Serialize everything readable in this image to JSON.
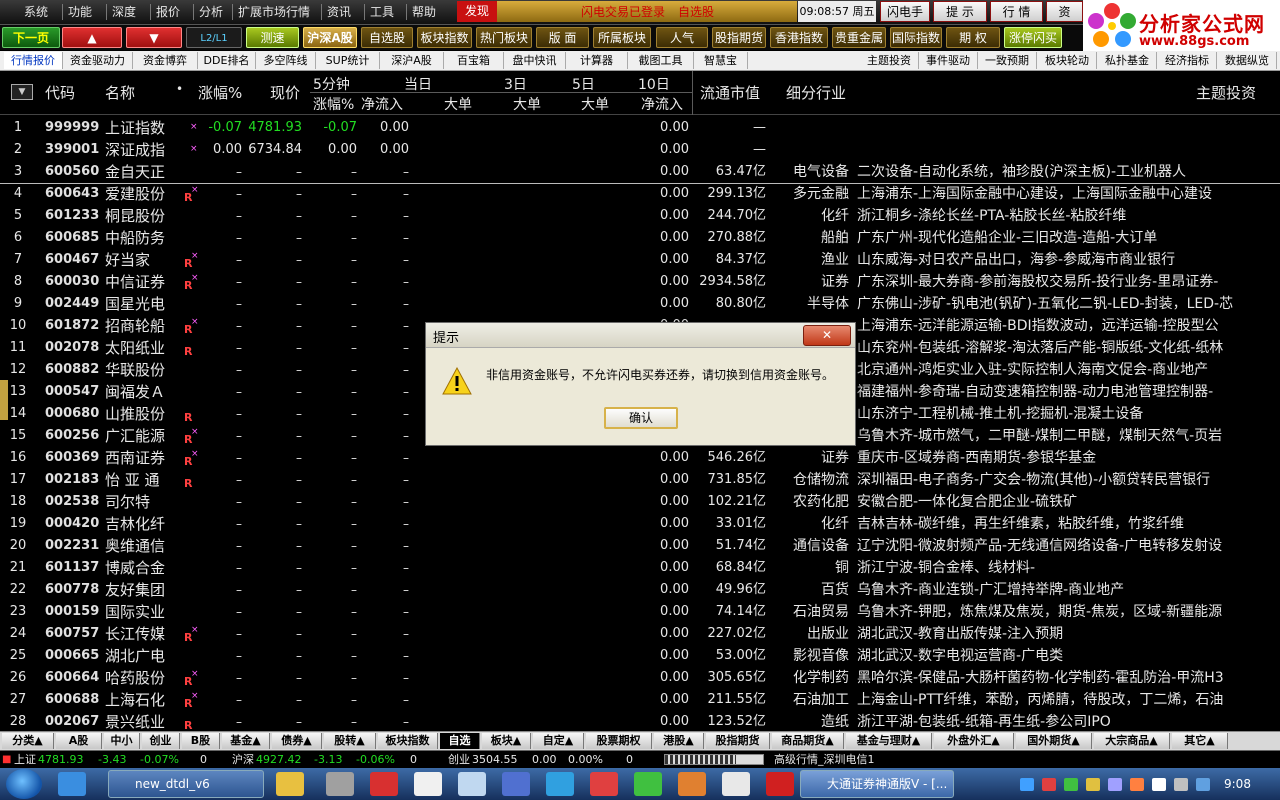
{
  "menu": {
    "items": [
      "系统",
      "功能",
      "深度",
      "报价",
      "分析",
      "扩展市场行情",
      "资讯",
      "工具",
      "帮助"
    ],
    "discover": "发现",
    "flash_status": "闪电交易已登录",
    "watchlist": "自选股",
    "time": "09:08:57 周五",
    "buttons": [
      "闪电手",
      "提 示",
      "行 情",
      "资"
    ]
  },
  "logo": {
    "title": "分析家公式网",
    "url": "www.88gs.com"
  },
  "toolbar": [
    {
      "label": "下一页>>",
      "style": "green"
    },
    {
      "label": "▲",
      "style": "red"
    },
    {
      "label": "▼",
      "style": "red"
    },
    {
      "label": "L2/L1",
      "style": "blue"
    },
    {
      "label": "测速",
      "style": "lime"
    },
    {
      "label": "沪深A股",
      "style": "sel"
    },
    {
      "label": "自选股",
      "style": "gold"
    },
    {
      "label": "板块指数",
      "style": "gold"
    },
    {
      "label": "热门板块",
      "style": "gold"
    },
    {
      "label": "版 面",
      "style": "gold"
    },
    {
      "label": "所属板块",
      "style": "gold"
    },
    {
      "label": "人气",
      "style": "gold"
    },
    {
      "label": "股指期货",
      "style": "gold"
    },
    {
      "label": "香港指数",
      "style": "gold"
    },
    {
      "label": "贵重金属",
      "style": "gold"
    },
    {
      "label": "国际指数",
      "style": "gold"
    },
    {
      "label": "期 权",
      "style": "gold"
    },
    {
      "label": "涨停闪买",
      "style": "lime"
    }
  ],
  "subtabs_left": [
    "行情报价",
    "资金驱动力",
    "资金博弈",
    "DDE排名",
    "多空阵线",
    "SUP统计",
    "深沪A股",
    "百宝箱",
    "盘中快讯",
    "计算器",
    "截图工具",
    "智慧宝"
  ],
  "subtabs_right": [
    "主题投资",
    "事件驱动",
    "一致预期",
    "板块轮动",
    "私扑基金",
    "经济指标",
    "数据纵览"
  ],
  "table": {
    "sort_icon": "▼",
    "headers": {
      "code": "代码",
      "name": "名称",
      "dot": "•",
      "chg": "涨幅%",
      "price": "现价",
      "min5": "5分钟",
      "min5_sub": "涨幅%",
      "today": "当日",
      "today_net": "净流入",
      "today_big": "大单",
      "d3": "3日",
      "d3_big": "大单",
      "d5": "5日",
      "d5_big": "大单",
      "d10": "10日",
      "d10_net": "净流入",
      "mcap": "流通市值",
      "industry": "细分行业",
      "theme": "主题投资"
    },
    "rows": [
      {
        "no": "1",
        "code": "999999",
        "name": "上证指数",
        "badge": "",
        "mark": "×",
        "chg": "-0.07",
        "price": "4781.93",
        "m5": "-0.07",
        "today": "0.00",
        "d10": "0.00",
        "mcap": "—",
        "ind": "",
        "theme": "",
        "hi": "green"
      },
      {
        "no": "2",
        "code": "399001",
        "name": "深证成指",
        "badge": "",
        "mark": "×",
        "chg": "0.00",
        "price": "6734.84",
        "m5": "0.00",
        "today": "0.00",
        "d10": "0.00",
        "mcap": "—",
        "ind": "",
        "theme": "",
        "hi": ""
      },
      {
        "no": "3",
        "code": "600560",
        "name": "金自天正",
        "badge": "",
        "mark": "",
        "chg": "–",
        "price": "–",
        "m5": "–",
        "today": "–",
        "d10": "0.00",
        "mcap": "63.47亿",
        "ind": "电气设备",
        "theme": "二次设备-自动化系统，袖珍股(沪深主板)-工业机器人",
        "hi": ""
      },
      {
        "no": "4",
        "code": "600643",
        "name": "爱建股份",
        "badge": "R",
        "mark": "×",
        "chg": "–",
        "price": "–",
        "m5": "–",
        "today": "–",
        "d10": "0.00",
        "mcap": "299.13亿",
        "ind": "多元金融",
        "theme": "上海浦东-上海国际金融中心建设，上海国际金融中心建设",
        "hi": ""
      },
      {
        "no": "5",
        "code": "601233",
        "name": "桐昆股份",
        "badge": "",
        "mark": "",
        "chg": "–",
        "price": "–",
        "m5": "–",
        "today": "–",
        "d10": "0.00",
        "mcap": "244.70亿",
        "ind": "化纤",
        "theme": "浙江桐乡-涤纶长丝-PTA-粘胶长丝-粘胶纤维",
        "hi": ""
      },
      {
        "no": "6",
        "code": "600685",
        "name": "中船防务",
        "badge": "",
        "mark": "",
        "chg": "–",
        "price": "–",
        "m5": "–",
        "today": "–",
        "d10": "0.00",
        "mcap": "270.88亿",
        "ind": "船舶",
        "theme": "广东广州-现代化造船企业-三旧改造-造船-大订单",
        "hi": ""
      },
      {
        "no": "7",
        "code": "600467",
        "name": "好当家",
        "badge": "R",
        "mark": "×",
        "chg": "–",
        "price": "–",
        "m5": "–",
        "today": "–",
        "d10": "0.00",
        "mcap": "84.37亿",
        "ind": "渔业",
        "theme": "山东威海-对日农产品出口，海参-参威海市商业银行",
        "hi": ""
      },
      {
        "no": "8",
        "code": "600030",
        "name": "中信证券",
        "badge": "R",
        "mark": "×",
        "chg": "–",
        "price": "–",
        "m5": "–",
        "today": "–",
        "d10": "0.00",
        "mcap": "2934.58亿",
        "ind": "证券",
        "theme": "广东深圳-最大券商-参前海股权交易所-投行业务-里昂证券-",
        "hi": ""
      },
      {
        "no": "9",
        "code": "002449",
        "name": "国星光电",
        "badge": "",
        "mark": "",
        "chg": "–",
        "price": "–",
        "m5": "–",
        "today": "–",
        "d10": "0.00",
        "mcap": "80.80亿",
        "ind": "半导体",
        "theme": "广东佛山-涉矿-钒电池(钒矿)-五氧化二钒-LED-封装，LED-芯",
        "hi": ""
      },
      {
        "no": "10",
        "code": "601872",
        "name": "招商轮船",
        "badge": "R",
        "mark": "×",
        "chg": "–",
        "price": "–",
        "m5": "–",
        "today": "–",
        "d10": "0.00",
        "mcap": "",
        "ind": "",
        "theme": "上海浦东-远洋能源运输-BDI指数波动，远洋运输-控股型公",
        "hi": ""
      },
      {
        "no": "11",
        "code": "002078",
        "name": "太阳纸业",
        "badge": "R",
        "mark": "",
        "chg": "–",
        "price": "–",
        "m5": "–",
        "today": "–",
        "d10": "0.00",
        "mcap": "",
        "ind": "",
        "theme": "山东兖州-包装纸-溶解浆-淘汰落后产能-铜版纸-文化纸-纸林",
        "hi": ""
      },
      {
        "no": "12",
        "code": "600882",
        "name": "华联股份",
        "badge": "",
        "mark": "",
        "chg": "–",
        "price": "–",
        "m5": "–",
        "today": "–",
        "d10": "0.00",
        "mcap": "",
        "ind": "",
        "theme": "北京通州-鸿炬实业入驻-实际控制人海南文促会-商业地产",
        "hi": ""
      },
      {
        "no": "13",
        "code": "000547",
        "name": "闽福发Ａ",
        "badge": "",
        "mark": "",
        "chg": "–",
        "price": "–",
        "m5": "–",
        "today": "–",
        "d10": "0.00",
        "mcap": "",
        "ind": "",
        "theme": "福建福州-参奇瑞-自动变速箱控制器-动力电池管理控制器-",
        "hi": ""
      },
      {
        "no": "14",
        "code": "000680",
        "name": "山推股份",
        "badge": "R",
        "mark": "",
        "chg": "–",
        "price": "–",
        "m5": "–",
        "today": "–",
        "d10": "0.00",
        "mcap": "",
        "ind": "",
        "theme": "山东济宁-工程机械-推土机-挖掘机-混凝土设备",
        "hi": ""
      },
      {
        "no": "15",
        "code": "600256",
        "name": "广汇能源",
        "badge": "R",
        "mark": "×",
        "chg": "–",
        "price": "–",
        "m5": "–",
        "today": "–",
        "d10": "0.00",
        "mcap": "",
        "ind": "",
        "theme": "乌鲁木齐-城市燃气，二甲醚-煤制二甲醚，煤制天然气-页岩",
        "hi": ""
      },
      {
        "no": "16",
        "code": "600369",
        "name": "西南证券",
        "badge": "R",
        "mark": "×",
        "chg": "–",
        "price": "–",
        "m5": "–",
        "today": "–",
        "d10": "0.00",
        "mcap": "546.26亿",
        "ind": "证券",
        "theme": "重庆市-区域券商-西南期货-参银华基金",
        "hi": ""
      },
      {
        "no": "17",
        "code": "002183",
        "name": "怡 亚 通",
        "badge": "R",
        "mark": "",
        "chg": "–",
        "price": "–",
        "m5": "–",
        "today": "–",
        "d10": "0.00",
        "mcap": "731.85亿",
        "ind": "仓储物流",
        "theme": "深圳福田-电子商务-广交会-物流(其他)-小额贷转民营银行",
        "hi": ""
      },
      {
        "no": "18",
        "code": "002538",
        "name": "司尔特",
        "badge": "",
        "mark": "",
        "chg": "–",
        "price": "–",
        "m5": "–",
        "today": "–",
        "d10": "0.00",
        "mcap": "102.21亿",
        "ind": "农药化肥",
        "theme": "安徽合肥-一体化复合肥企业-硫铁矿",
        "hi": ""
      },
      {
        "no": "19",
        "code": "000420",
        "name": "吉林化纤",
        "badge": "",
        "mark": "",
        "chg": "–",
        "price": "–",
        "m5": "–",
        "today": "–",
        "d10": "0.00",
        "mcap": "33.01亿",
        "ind": "化纤",
        "theme": "吉林吉林-碳纤维，再生纤维素，粘胶纤维，竹浆纤维",
        "hi": ""
      },
      {
        "no": "20",
        "code": "002231",
        "name": "奥维通信",
        "badge": "",
        "mark": "",
        "chg": "–",
        "price": "–",
        "m5": "–",
        "today": "–",
        "d10": "0.00",
        "mcap": "51.74亿",
        "ind": "通信设备",
        "theme": "辽宁沈阳-微波射频产品-无线通信网络设备-广电转移发射设",
        "hi": ""
      },
      {
        "no": "21",
        "code": "601137",
        "name": "博威合金",
        "badge": "",
        "mark": "",
        "chg": "–",
        "price": "–",
        "m5": "–",
        "today": "–",
        "d10": "0.00",
        "mcap": "68.84亿",
        "ind": "铜",
        "theme": "浙江宁波-铜合金棒、线材料-",
        "hi": ""
      },
      {
        "no": "22",
        "code": "600778",
        "name": "友好集团",
        "badge": "",
        "mark": "",
        "chg": "–",
        "price": "–",
        "m5": "–",
        "today": "–",
        "d10": "0.00",
        "mcap": "49.96亿",
        "ind": "百货",
        "theme": "乌鲁木齐-商业连锁-广汇增持举牌-商业地产",
        "hi": ""
      },
      {
        "no": "23",
        "code": "000159",
        "name": "国际实业",
        "badge": "",
        "mark": "",
        "chg": "–",
        "price": "–",
        "m5": "–",
        "today": "–",
        "d10": "0.00",
        "mcap": "74.14亿",
        "ind": "石油贸易",
        "theme": "乌鲁木齐-钾肥，炼焦煤及焦炭，期货-焦炭，区域-新疆能源",
        "hi": ""
      },
      {
        "no": "24",
        "code": "600757",
        "name": "长江传媒",
        "badge": "R",
        "mark": "×",
        "chg": "–",
        "price": "–",
        "m5": "–",
        "today": "–",
        "d10": "0.00",
        "mcap": "227.02亿",
        "ind": "出版业",
        "theme": "湖北武汉-教育出版传媒-注入预期",
        "hi": ""
      },
      {
        "no": "25",
        "code": "000665",
        "name": "湖北广电",
        "badge": "",
        "mark": "",
        "chg": "–",
        "price": "–",
        "m5": "–",
        "today": "–",
        "d10": "0.00",
        "mcap": "53.00亿",
        "ind": "影视音像",
        "theme": "湖北武汉-数字电视运营商-广电类",
        "hi": ""
      },
      {
        "no": "26",
        "code": "600664",
        "name": "哈药股份",
        "badge": "R",
        "mark": "×",
        "chg": "–",
        "price": "–",
        "m5": "–",
        "today": "–",
        "d10": "0.00",
        "mcap": "305.65亿",
        "ind": "化学制药",
        "theme": "黑哈尔滨-保健品-大肠杆菌药物-化学制药-霍乱防治-甲流H3",
        "hi": ""
      },
      {
        "no": "27",
        "code": "600688",
        "name": "上海石化",
        "badge": "R",
        "mark": "×",
        "chg": "–",
        "price": "–",
        "m5": "–",
        "today": "–",
        "d10": "0.00",
        "mcap": "211.55亿",
        "ind": "石油加工",
        "theme": "上海金山-PTT纤维，苯酚，丙烯腈，待股改，丁二烯，石油",
        "hi": ""
      },
      {
        "no": "28",
        "code": "002067",
        "name": "景兴纸业",
        "badge": "R",
        "mark": "",
        "chg": "–",
        "price": "–",
        "m5": "–",
        "today": "–",
        "d10": "0.00",
        "mcap": "123.52亿",
        "ind": "造纸",
        "theme": "浙江平湖-包装纸-纸箱-再生纸-参公司IPO",
        "hi": ""
      }
    ]
  },
  "dialog": {
    "title": "提示",
    "close": "✕",
    "message": "非信用资金账号，不允许闪电买券还券，请切换到信用资金账号。",
    "ok": "确认"
  },
  "bottom_tabs": [
    "分类▲",
    "A股",
    "中小",
    "创业",
    "B股",
    "基金▲",
    "债券▲",
    "股转▲",
    "板块指数",
    "自选",
    "板块▲",
    "自定▲",
    "股票期权",
    "港股▲",
    "股指期货",
    "商品期货▲",
    "基金与理财▲",
    "外盘外汇▲",
    "国外期货▲",
    "大宗商品▲",
    "其它▲"
  ],
  "status": {
    "sh_label": "上证",
    "sh_val": "4781.93",
    "sh_chg": "-3.43",
    "sh_pct": "-0.07%",
    "sh_vol": "0",
    "hs_label": "沪深",
    "hs_val": "4927.42",
    "hs_chg": "-3.13",
    "hs_pct": "-0.06%",
    "hs_vol": "0",
    "cy_label": "创业",
    "cy_val": "3504.55",
    "cy_chg": "0.00",
    "cy_pct": "0.00%",
    "cy_vol": "0",
    "progress": 0.72,
    "server": "高级行情_深圳电信1"
  },
  "taskbar": {
    "tasks": [
      "new_dtdl_v6",
      "大通证券神通版V - [..."
    ],
    "time": "9:08"
  },
  "colors": {
    "accent_gold": "#b08a2a",
    "up": "#ff3030",
    "down": "#22dd22"
  }
}
